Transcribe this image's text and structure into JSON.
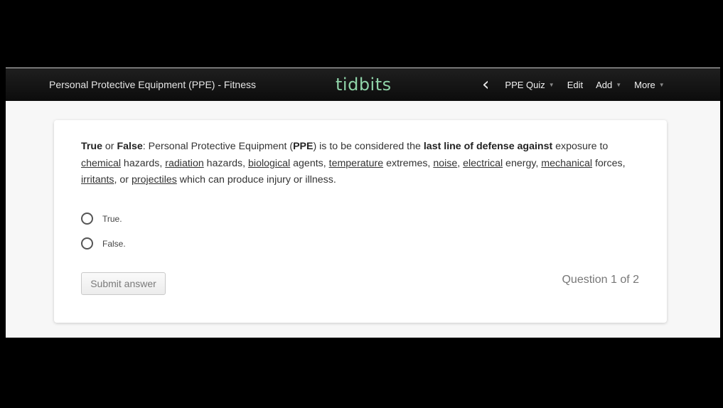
{
  "header": {
    "course_title": "Personal Protective Equipment (PPE) - Fitness",
    "logo": "tidbits",
    "nav": {
      "back_icon": "chevron-left-icon",
      "items": [
        {
          "label": "PPE Quiz",
          "dropdown": true
        },
        {
          "label": "Edit",
          "dropdown": false
        },
        {
          "label": "Add",
          "dropdown": true
        },
        {
          "label": "More",
          "dropdown": true
        }
      ]
    }
  },
  "question": {
    "segments": [
      {
        "text": "True",
        "style": "bold"
      },
      {
        "text": " or ",
        "style": "normal"
      },
      {
        "text": "False",
        "style": "bold"
      },
      {
        "text": ": Personal Protective Equipment (",
        "style": "normal"
      },
      {
        "text": "PPE",
        "style": "bold"
      },
      {
        "text": ") is to be considered the ",
        "style": "normal"
      },
      {
        "text": "last line of defense against",
        "style": "bold"
      },
      {
        "text": " exposure to ",
        "style": "normal"
      },
      {
        "text": "chemical",
        "style": "underline"
      },
      {
        "text": " hazards, ",
        "style": "normal"
      },
      {
        "text": "radiation",
        "style": "underline"
      },
      {
        "text": " hazards, ",
        "style": "normal"
      },
      {
        "text": "biological",
        "style": "underline"
      },
      {
        "text": " agents, ",
        "style": "normal"
      },
      {
        "text": "temperature",
        "style": "underline"
      },
      {
        "text": " extremes, ",
        "style": "normal"
      },
      {
        "text": "noise",
        "style": "underline"
      },
      {
        "text": ", ",
        "style": "normal"
      },
      {
        "text": "electrical",
        "style": "underline"
      },
      {
        "text": " energy, ",
        "style": "normal"
      },
      {
        "text": "mechanical",
        "style": "underline"
      },
      {
        "text": " forces, ",
        "style": "normal"
      },
      {
        "text": "irritants",
        "style": "underline"
      },
      {
        "text": ", or ",
        "style": "normal"
      },
      {
        "text": "projectiles",
        "style": "underline"
      },
      {
        "text": " which can produce injury or illness.",
        "style": "normal"
      }
    ],
    "options": [
      {
        "label": "True.",
        "selected": false
      },
      {
        "label": "False.",
        "selected": false
      }
    ],
    "submit_label": "Submit answer",
    "progress": "Question 1 of 2"
  },
  "colors": {
    "logo": "#8fd3a8",
    "topbar": "#111111",
    "background": "#f7f7f7"
  }
}
